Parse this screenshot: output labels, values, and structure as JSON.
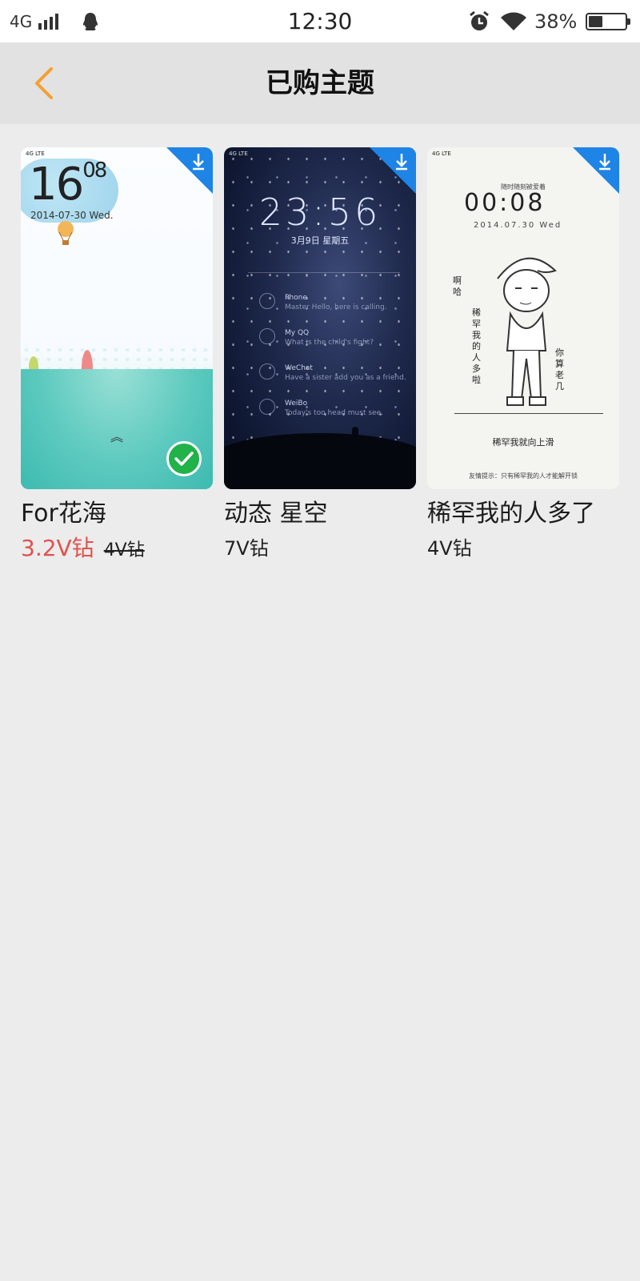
{
  "status_bar": {
    "network": "4G",
    "time": "12:30",
    "battery": "38%",
    "battery_level": 0.38
  },
  "header": {
    "title": "已购主题",
    "accent_color": "#f5a030"
  },
  "themes": [
    {
      "name": "For花海",
      "sale_price": "3.2V钻",
      "original_price": "4V钻",
      "applied": true,
      "preview": {
        "mini_status": "4G LTE",
        "time_hour": "16",
        "time_min": "08",
        "date": "2014-07-30 Wed."
      }
    },
    {
      "name": "动态 星空",
      "price": "7V钻",
      "applied": false,
      "preview": {
        "mini_status": "4G LTE",
        "time": "23:56",
        "date": "3月9日 星期五",
        "rows": [
          {
            "title": "Phone",
            "sub": "Master Hello, here is calling."
          },
          {
            "title": "My QQ",
            "sub": "What is the child's fight?"
          },
          {
            "title": "WeChat",
            "sub": "Have a sister add you as a friend."
          },
          {
            "title": "WeiBo",
            "sub": "Today's too head must see."
          }
        ]
      }
    },
    {
      "name": "稀罕我的人多了",
      "price": "4V钻",
      "applied": false,
      "preview": {
        "mini_status": "4G LTE",
        "subtitle": "随时随刻被爱着",
        "time": "00:08",
        "date": "2014.07.30  Wed",
        "left_text": "啊哈",
        "mid_text": "稀罕我的人多啦",
        "right_text": "你算老几",
        "bottom_text": "稀罕我就向上滑",
        "tip": "友情提示：只有稀罕我的人才能解开锁"
      }
    }
  ]
}
